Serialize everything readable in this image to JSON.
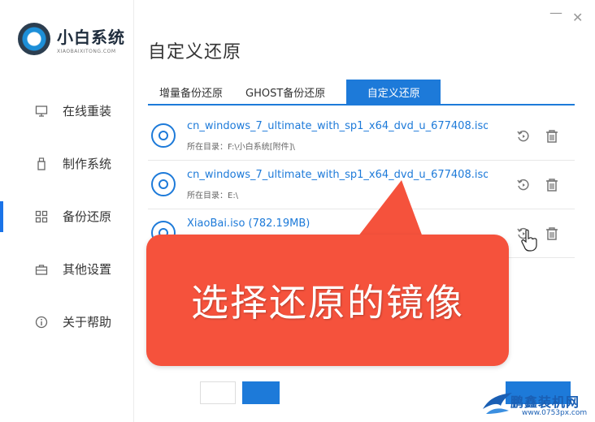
{
  "app": {
    "title": "小白系统",
    "subtitle": "XIAOBAIXITONG.COM"
  },
  "window_controls": {
    "minimize": "—",
    "close": "✕"
  },
  "sidebar": {
    "items": [
      {
        "label": "在线重装",
        "icon": "monitor-icon"
      },
      {
        "label": "制作系统",
        "icon": "usb-icon"
      },
      {
        "label": "备份还原",
        "icon": "grid-icon",
        "active": true
      },
      {
        "label": "其他设置",
        "icon": "briefcase-icon"
      },
      {
        "label": "关于帮助",
        "icon": "info-icon"
      }
    ]
  },
  "main": {
    "title": "自定义还原",
    "tabs": [
      {
        "label": "增量备份还原"
      },
      {
        "label": "GHOST备份还原"
      },
      {
        "label": "自定义还原",
        "active": true
      }
    ],
    "files": [
      {
        "name": "cn_windows_7_ultimate_with_sp1_x64_dvd_u_677408.iso (3...",
        "dir": "所在目录：F:\\小白系统[附件]\\"
      },
      {
        "name": "cn_windows_7_ultimate_with_sp1_x64_dvd_u_677408.iso (3...",
        "dir": "所在目录：E:\\"
      },
      {
        "name": "XiaoBai.iso (782.19MB)",
        "dir": ""
      }
    ]
  },
  "callout": {
    "text": "选择还原的镜像",
    "color": "#f5523c"
  },
  "watermark": {
    "title": "鹏鑫装机网",
    "url": "www.0753px.com"
  },
  "colors": {
    "accent": "#1d7ad9"
  }
}
